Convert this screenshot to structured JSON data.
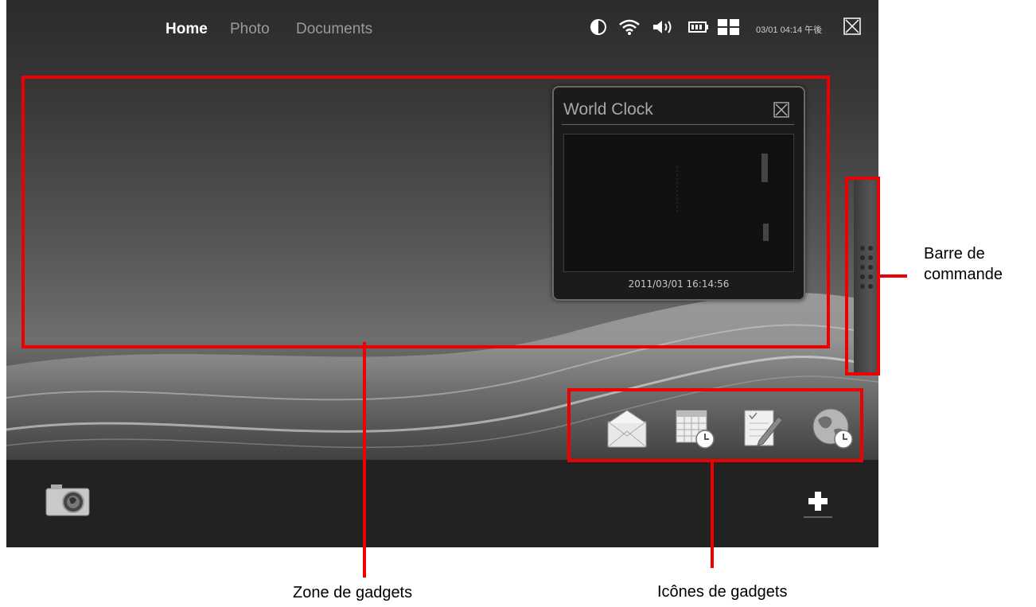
{
  "nav": {
    "tabs": [
      "Home",
      "Photo",
      "Documents"
    ],
    "active": "Home"
  },
  "status": {
    "datetime": "03/01 04:14 午後",
    "icons": [
      "brightness-icon",
      "wifi-icon",
      "volume-icon",
      "battery-icon",
      "layout-grid-icon",
      "close-icon"
    ]
  },
  "world_clock": {
    "title": "World Clock",
    "time": "2011/03/01 16:14:56"
  },
  "gadget_icons": [
    "mail-icon",
    "calendar-clock-icon",
    "notes-pencil-icon",
    "globe-clock-icon"
  ],
  "bottom": {
    "left_icon": "camera-globe-icon",
    "right_icon": "add-icon"
  },
  "annotations": {
    "gadget_zone": "Zone de gadgets",
    "gadget_icons": "Icônes de gadgets",
    "command_bar": "Barre de\ncommande"
  },
  "colors": {
    "highlight_red": "#ee0000",
    "screen_dark": "#2b2b2b",
    "bottom_bar": "#222222"
  }
}
